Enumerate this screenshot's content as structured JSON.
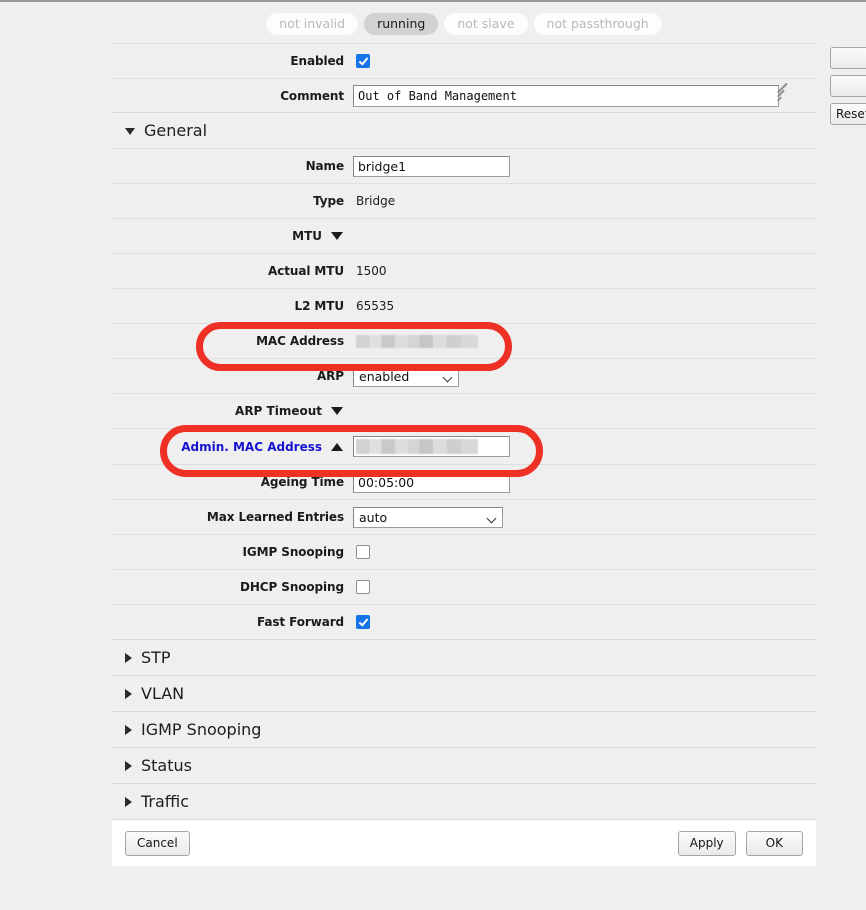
{
  "status_pills": [
    {
      "label": "not invalid",
      "active": false
    },
    {
      "label": "running",
      "active": true
    },
    {
      "label": "not slave",
      "active": false
    },
    {
      "label": "not passthrough",
      "active": false
    }
  ],
  "top_fields": {
    "enabled_label": "Enabled",
    "enabled_checked": "true",
    "comment_label": "Comment",
    "comment_value": "Out of Band Management"
  },
  "sections": {
    "general": {
      "title": "General",
      "expanded": "true",
      "rows": {
        "name_label": "Name",
        "name_value": "bridge1",
        "type_label": "Type",
        "type_value": "Bridge",
        "mtu_label": "MTU",
        "actual_mtu_label": "Actual MTU",
        "actual_mtu_value": "1500",
        "l2_mtu_label": "L2 MTU",
        "l2_mtu_value": "65535",
        "mac_address_label": "MAC Address",
        "mac_address_value": "",
        "arp_label": "ARP",
        "arp_value": "enabled",
        "arp_timeout_label": "ARP Timeout",
        "admin_mac_label": "Admin. MAC Address",
        "admin_mac_value": "",
        "ageing_time_label": "Ageing Time",
        "ageing_time_value": "00:05:00",
        "max_learned_label": "Max Learned Entries",
        "max_learned_value": "auto",
        "igmp_snooping_label": "IGMP Snooping",
        "igmp_snooping_checked": "false",
        "dhcp_snooping_label": "DHCP Snooping",
        "dhcp_snooping_checked": "false",
        "fast_forward_label": "Fast Forward",
        "fast_forward_checked": "true"
      }
    },
    "collapsed": [
      {
        "title": "STP"
      },
      {
        "title": "VLAN"
      },
      {
        "title": "IGMP Snooping"
      },
      {
        "title": "Status"
      },
      {
        "title": "Traffic"
      }
    ]
  },
  "footer": {
    "cancel_label": "Cancel",
    "apply_label": "Apply",
    "ok_label": "OK"
  },
  "side_buttons": [
    {
      "label": ""
    },
    {
      "label": ""
    },
    {
      "label": "Reset"
    }
  ],
  "colors": {
    "annotation": "#ee3124",
    "checkbox_checked": "#1773e8",
    "link_label": "#1414cf",
    "background": "#efefef"
  }
}
